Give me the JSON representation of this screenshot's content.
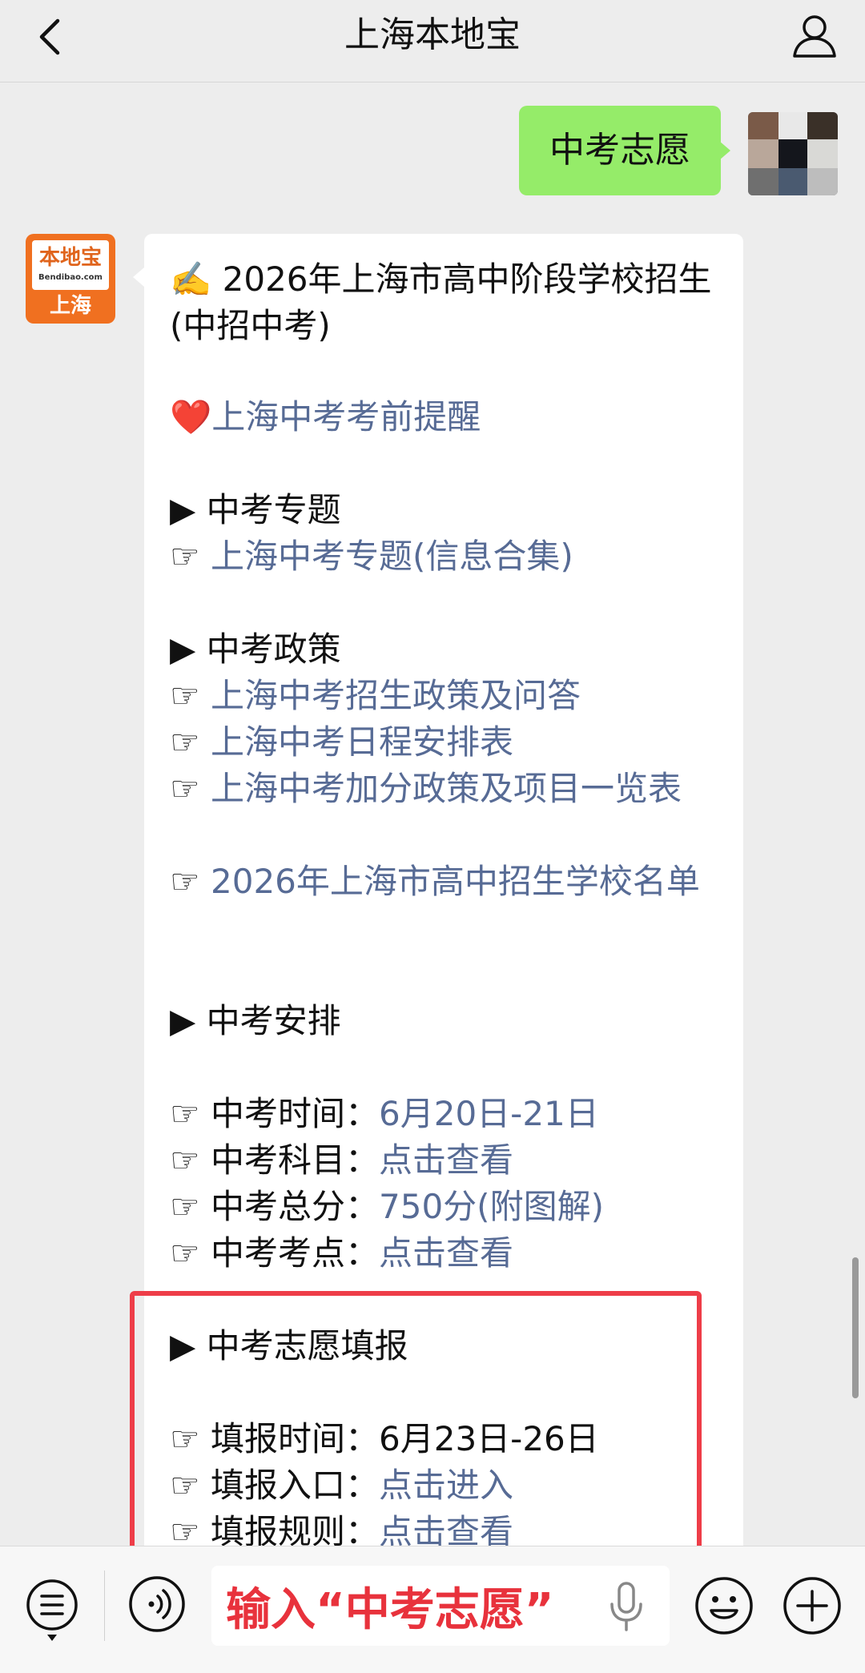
{
  "header": {
    "title": "上海本地宝",
    "back_icon": "chevron-left-icon",
    "profile_icon": "person-icon"
  },
  "outgoing_message": {
    "text": "中考志愿",
    "bubble_color": "#95ec69"
  },
  "bot": {
    "avatar_logo_text": "本地宝",
    "avatar_logo_sub": "Bendibao.com",
    "avatar_city": "上海"
  },
  "message": {
    "l1": "✍️ 2026年上海市高中阶段学校招生(中招中考)",
    "l2_heart": "❤️",
    "l2_link": "上海中考考前提醒",
    "s1_title": "▶ 中考专题",
    "s1_i1_hand": "☞ ",
    "s1_i1_link": "上海中考专题(信息合集)",
    "s2_title": "▶ 中考政策",
    "s2_i1_hand": "☞ ",
    "s2_i1_link": "上海中考招生政策及问答",
    "s2_i2_hand": "☞ ",
    "s2_i2_link": "上海中考日程安排表",
    "s2_i3_hand": "☞ ",
    "s2_i3_link": "上海中考加分政策及项目一览表",
    "s2_i4_hand": "☞ ",
    "s2_i4_link": "2026年上海市高中招生学校名单",
    "s3_title": "▶ 中考安排",
    "s3_i1_label": "☞ 中考时间：",
    "s3_i1_link": "6月20日-21日",
    "s3_i2_label": "☞ 中考科目：",
    "s3_i2_link": "点击查看",
    "s3_i3_label": "☞ 中考总分：",
    "s3_i3_link": "750分(附图解)",
    "s3_i4_label": "☞ 中考考点：",
    "s3_i4_link": "点击查看",
    "s4_title": "▶ 中考志愿填报",
    "s4_i1_label": "☞ 填报时间：",
    "s4_i1_value": "6月23日-26日",
    "s4_i2_label": "☞ 填报入口：",
    "s4_i2_link": "点击进入",
    "s4_i3_label": "☞ 填报规则：",
    "s4_i3_link": "点击查看",
    "link_color": "#576b95",
    "highlight_color": "#ee3d48"
  },
  "input_bar": {
    "input_value": "输入“中考志愿”",
    "menu_icon": "list-menu-icon",
    "voice_icon": "voice-icon",
    "mic_icon": "microphone-icon",
    "emoji_icon": "smiley-icon",
    "plus_icon": "plus-circle-icon",
    "input_text_color": "#e8323c"
  }
}
